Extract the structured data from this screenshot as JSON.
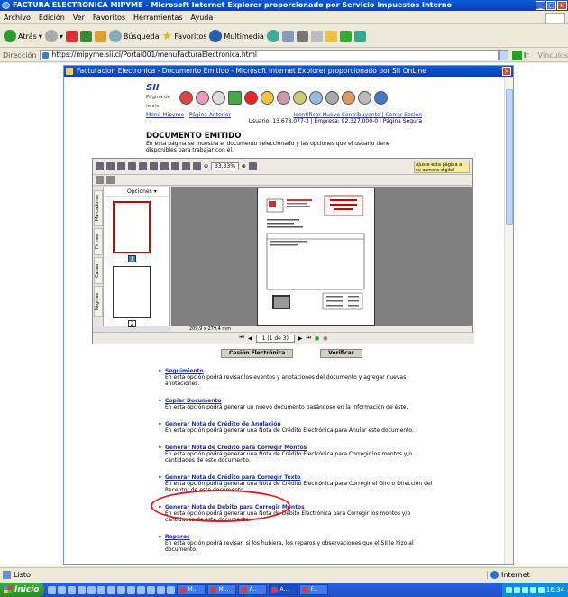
{
  "window": {
    "title": "FACTURA ELECTRONICA MIPYME - Microsoft Internet Explorer proporcionado por Servicio Impuestos Interno"
  },
  "menu": [
    "Archivo",
    "Edición",
    "Ver",
    "Favoritos",
    "Herramientas",
    "Ayuda"
  ],
  "toolbar": {
    "back": "Atrás",
    "search": "Búsqueda",
    "favorites": "Favoritos",
    "multimedia": "Multimedia"
  },
  "address": {
    "label": "Dirección",
    "url": "https://mipyme.sii.cl/Portal001/menuFacturaElectronica.html",
    "go": "Ir",
    "links": "Vínculos"
  },
  "popup": {
    "title": "Facturacion Electronica - Documento Emitido - Microsoft Internet Explorer proporcionado por SII OnLine",
    "logo": "SII",
    "logo_sub": "Página de inicio",
    "nav_left": [
      "Menú Mipyme",
      "Página Anterior"
    ],
    "nav_right_top": "Identificar Nuevo Contribuyente | Cerrar Sesión",
    "nav_right_user": "Usuario: 13.678.077-3 | Empresa: 92.327.000-0 | Página Segura",
    "page_title": "DOCUMENTO EMITIDO",
    "page_desc": "En esta página se muestra el documento seleccionado y las opciones que el usuario tiene disponibles para trabajar con él."
  },
  "viewer": {
    "zoom": "33,33%",
    "options": "Opciones",
    "tabs": [
      "Marcadores",
      "Firmas",
      "Capas",
      "Páginas"
    ],
    "thumb_pages": [
      "1",
      "2"
    ],
    "page_size": "209,9 x 279,4 mm",
    "page_nav": "1 (1 de 3)",
    "promo": "Ajuste esta página a su cámara digital"
  },
  "buttons": {
    "cesion": "Cesión Electrónica",
    "verificar": "Verificar"
  },
  "options": [
    {
      "title": "Seguimiento",
      "desc": "En esta opción podrá revisar los eventos y anotaciones del documento y agregar nuevas anotaciones."
    },
    {
      "title": "Copiar Documento",
      "desc": "En esta opción podrá generar un nuevo documento basándose en la información de éste."
    },
    {
      "title": "Generar Nota de Crédito de Anulación",
      "desc": "En esta opción podrá generar una Nota de Crédito Electrónica para Anular este documento."
    },
    {
      "title": "Generar Nota de Crédito para Corregir Montos",
      "desc": "En esta opción podrá generar una Nota de Crédito Electrónica para Corregir los montos y/o cantidades de este documento."
    },
    {
      "title": "Generar Nota de Crédito para Corregir Texto",
      "desc": "En esta opción podrá generar una Nota de Crédito Electrónica para Corregir el Giro o Dirección del Receptor de este documento."
    },
    {
      "title": "Generar Nota de Débito para Corregir Montos",
      "desc": "En esta opción podrá generar una Nota de Débito Electrónica para Corregir los montos y/o cantidades de este documento."
    },
    {
      "title": "Reparos",
      "desc": "En esta opción podrá revisar, si los hubiera, los reparos y observaciones que el SII le hizo al documento."
    }
  ],
  "status": {
    "left": "Listo",
    "zone": "Internet"
  },
  "taskbar": {
    "start": "Inicio",
    "tasks": [
      "M...",
      "M...",
      "A...",
      "A...",
      "F..."
    ],
    "clock": "16:34"
  }
}
